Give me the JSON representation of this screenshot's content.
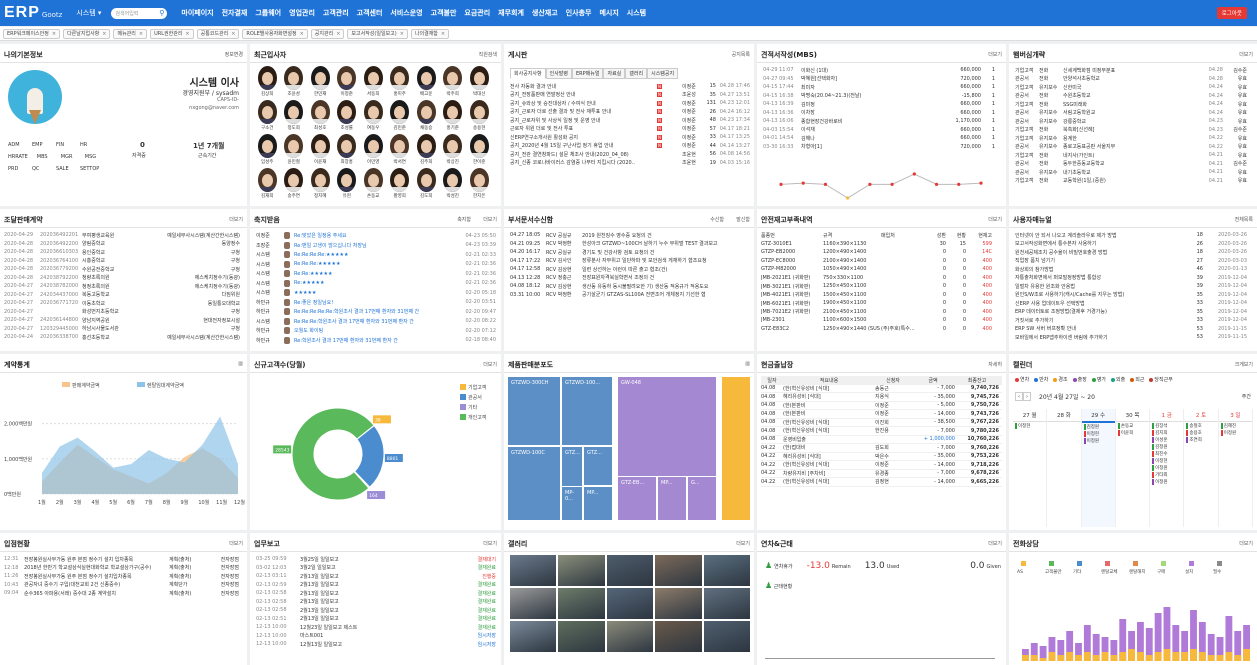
{
  "topbar": {
    "logo": "ERP",
    "logo_sub": "Gootz",
    "system_menu": "시스템 ▾",
    "search_placeholder": "검색어입력",
    "logout": "로그아웃",
    "menus": [
      "마이페이지",
      "전자결재",
      "그룹웨어",
      "영업관리",
      "고객관리",
      "고객센터",
      "서비스운영",
      "고객불만",
      "요금관리",
      "재무회계",
      "생산재고",
      "인사총무",
      "메시지",
      "시스템"
    ]
  },
  "tabs": [
    "ERP워크페이스안정",
    "다른날지업사항",
    "메뉴관리",
    "URL권한관리",
    "공통코드관리",
    "ROLE별사용자화면설정",
    "공지관리",
    "보고서작성(일일보고)",
    "나의결재함"
  ],
  "profile": {
    "title": "나의기본정보",
    "manage": "정보변경",
    "name": "시스템 이사",
    "org": "경영지원부 / sysadm",
    "caps": "CAPS-ID-",
    "email": "nxgong@naver.com",
    "roles": [
      "ADM",
      "EMP",
      "FIN",
      "HR",
      "HRRATE",
      "MBS",
      "MGR",
      "MSG",
      "PRD",
      "QC",
      "SALE",
      "SETTOP"
    ],
    "stat1_value": "0",
    "stat1_label": "자격증",
    "stat2_value": "1년 7개월",
    "stat2_label": "근속기간"
  },
  "recent_users": {
    "title": "최근입사자",
    "names": [
      "김상희",
      "조윤성",
      "한민재",
      "이정준",
      "서동희",
      "홍미주",
      "배고운",
      "박주희",
      "박대선",
      "구소건",
      "정도희",
      "최성호",
      "조성률",
      "여동우",
      "김민준",
      "채동승",
      "홍기준",
      "송용현",
      "임성주",
      "윤민철",
      "이윤재",
      "최장홍",
      "이민영",
      "박서연",
      "김주희",
      "박상진",
      "한이준",
      "김재희",
      "송주연",
      "정지혜",
      "유현",
      "손동교",
      "황영희",
      "김도희",
      "박성진",
      "한지은"
    ]
  },
  "board": {
    "title": "게시판",
    "more": "공지목록",
    "tabs": [
      "회사공지사항",
      "인사발령",
      "ERP매뉴얼",
      "자료실",
      "갤러리",
      "시스템공지"
    ],
    "rows": [
      [
        "전사 자동화 결과 안내",
        "이정준",
        "15",
        "04.28 17:46"
      ],
      [
        "공지_전장품판매 연말정산 안내",
        "조윤성",
        "35",
        "04.27 13:51"
      ],
      [
        "공지_슈와상 및 승진대상자 / 수여식 안내",
        "이정준",
        "131",
        "04.23 12:01"
      ],
      [
        "공지_근로자 더로 선출 결과 및 전사 재투표 안내",
        "이정준",
        "26",
        "04.24 16:12"
      ],
      [
        "공지_근로자위 및 사상식 일정 및 운영 안내",
        "이정준",
        "48",
        "04.23 17:34"
      ],
      [
        "근로자 위원 더로 및 전사 투표",
        "이정준",
        "57",
        "04.17 18:21"
      ],
      [
        "신ERP연구소개사원 활성화 공지",
        "이정준",
        "33",
        "04.17 13:25"
      ],
      [
        "공지_2020년 4월 15일 구난사업 정기 휴업 안내",
        "이정준",
        "44",
        "04.14 13:27"
      ],
      [
        "공지_전관 결연창파드) 설문 체조사 안내(2020_04_08)",
        "조윤현",
        "56",
        "04.08 14:56"
      ],
      [
        "공지_신종 코로나바이러스 감염증 나부터 지킵시다 (2020..",
        "조윤현",
        "19",
        "04.03 15:16"
      ]
    ]
  },
  "mbs": {
    "title": "견적서작성(MBS)",
    "more": "더보기",
    "rows": [
      [
        "04-29 11:07",
        "이화신 (1대)",
        "660,000",
        "1"
      ],
      [
        "04-27 09:45",
        "박혜원[선택화자]",
        "720,000",
        "1"
      ],
      [
        "04-15 17:44",
        "최미자",
        "660,000",
        "1"
      ],
      [
        "04-15 16:38",
        "박명숙(20.04~21.3)(전날)",
        "-15,800",
        "1"
      ],
      [
        "04-13 16:39",
        "김미정",
        "660,000",
        "1"
      ],
      [
        "04-13 16:36",
        "이차장",
        "660,000",
        "1"
      ],
      [
        "04-13 16:06",
        "종합현장건강바로비",
        "1,170,000",
        "1"
      ],
      [
        "04-03 15:54",
        "이석재",
        "660,000",
        "1"
      ],
      [
        "04-01 14:54",
        "김해나",
        "660,000",
        "1"
      ],
      [
        "03-30 16:33",
        "차형아[1]",
        "720,000",
        "1"
      ]
    ],
    "spark": [
      660000,
      720000,
      660000,
      -15800,
      660000,
      660000,
      1170000,
      660000,
      660000,
      720000
    ]
  },
  "prospect": {
    "title": "햄버심개략",
    "more": "더보기",
    "rows": [
      [
        "기업고객",
        "전화",
        "신세계백화점 미정부분표",
        "04.28",
        "김수준"
      ],
      [
        "관공서",
        "전화",
        "안양석사초등학교",
        "04.28",
        "유효"
      ],
      [
        "기업고객",
        "유지보수",
        "신한미국",
        "04.24",
        "유효"
      ],
      [
        "관공서",
        "전화",
        "수원초등학교",
        "04.24",
        "유효"
      ],
      [
        "기업고객",
        "전화",
        "SSG미래화",
        "04.24",
        "유효"
      ],
      [
        "관공서",
        "유지보수",
        "서림고등학원교",
        "04.24",
        "유효"
      ],
      [
        "관공서",
        "유지보수",
        "강릉중학교",
        "04.23",
        "유효"
      ],
      [
        "기업고객",
        "전화",
        "북측화[신선례]",
        "04.23",
        "김수준"
      ],
      [
        "기업고객",
        "유지보수",
        "용계한",
        "04.22",
        "유효"
      ],
      [
        "관공서",
        "유지보수",
        "종로고등표공판 서울지부",
        "04.22",
        "유효"
      ],
      [
        "기업고객",
        "전화",
        "네지사(가인트)",
        "04.21",
        "유효"
      ],
      [
        "관공서",
        "전화",
        "동두한중동교등학교",
        "04.21",
        "김수준"
      ],
      [
        "관공서",
        "유지보수",
        "내기초등학교",
        "04.21",
        "유효"
      ],
      [
        "기업고객",
        "전화",
        "교동학원(1일,(중원)",
        "04.21",
        "유효"
      ]
    ]
  },
  "contracts": {
    "title": "조달판매계약",
    "more": "더보기",
    "rows": [
      [
        "2020-04-29",
        "202036492201",
        "부여평생교육원",
        "예일세무사시스템(계산간한시스템)"
      ],
      [
        "2020-04-28",
        "202036492200",
        "양림중학교",
        "동양정수"
      ],
      [
        "2020-04-28",
        "202036610303",
        "용인중학교",
        "구청"
      ],
      [
        "2020-04-28",
        "202036764100",
        "시흥중학교",
        "구청"
      ],
      [
        "2020-04-28",
        "202036779200",
        "수원공전중학교",
        "구청"
      ],
      [
        "2020-04-28",
        "242038792200",
        "청량초록의원",
        "에스케치정수기(동광)"
      ],
      [
        "2020-04-27",
        "242038782000",
        "청정초록의원",
        "에스케치정수기(동광)"
      ],
      [
        "2020-04-27",
        "242034437000",
        "복동고등학교",
        "다짐위원"
      ],
      [
        "2020-04-27",
        "202036771720",
        "이동초학교",
        "동일통오대학교"
      ],
      [
        "2020-04-27",
        "",
        "화성번지초등학교",
        "구청"
      ],
      [
        "2020-04-27",
        "242036144800",
        "양남지역공원",
        "현대전자정보시설"
      ],
      [
        "2020-04-27",
        "120329445000",
        "하남시사물도서관",
        "구청"
      ],
      [
        "2020-04-24",
        "202036338700",
        "홍선초등학교",
        "예일세무사시스템(계산간한시스템)"
      ]
    ]
  },
  "congrats": {
    "title": "축지받음",
    "more": "더보기",
    "more2": "축지함",
    "rows": [
      [
        "이정준",
        "Re:맞았은 일정용 주세요",
        "04-23 05:50"
      ],
      [
        "조장준",
        "Re:맨일 고생이 많으십니다 처장님",
        "04-23 03:39"
      ],
      [
        "시스템",
        "Re:Re:Re:Re:★★★★★",
        "02-21 02:33"
      ],
      [
        "시스템",
        "Re:Re:Re:★★★★★",
        "02-21 02:36"
      ],
      [
        "시스템",
        "Re:Re:★★★★★",
        "02-21 02:36"
      ],
      [
        "시스템",
        "Re:★★★★★",
        "02-21 02:36"
      ],
      [
        "시스템",
        "★★★★★",
        "02-20 05:18"
      ],
      [
        "하민규",
        "Re:좋은 정일님요!",
        "02-20 03:51"
      ],
      [
        "하민규",
        "Re:Re:Re:Re:Re:학원조사 결과 17번째 환자와 31번째 간",
        "02-20 09:47"
      ],
      [
        "시스템",
        "Re:Re:Re:학원조사 결과 17번째 환자와 31번째 환자 간",
        "02-20 08:22"
      ],
      [
        "하민규",
        "오월도 화이팅",
        "02-20 07:12"
      ],
      [
        "하민규",
        "Re:학원조사 결과 17번째 환자와 31번째 환자 간",
        "02-18 08:40"
      ]
    ]
  },
  "received_docs": {
    "title": "부서문서수신함",
    "more": "수신함",
    "more2": "발신함",
    "rows": [
      [
        "04.27 18:05",
        "RCV 공실규",
        "2019 원천징수 영수증 요청의 건"
      ],
      [
        "04.21 09:25",
        "RCV 박정환",
        "한성아크 GTZWD~100CH 날하기 누수 부위벌 TEST 결과보고"
      ],
      [
        "04.20 16:17",
        "RCV 공실규",
        "경기도 및 건강사항 검토 요청의 건"
      ],
      [
        "04.17 17:22",
        "RCV 김사인",
        "장류분사 자부위고 일단하파 및 보안검색 게재하기 협조요청"
      ],
      [
        "04.17 12:58",
        "RCV 김상현",
        "일련 상선하는 이런이 따른 출고 협조(건)"
      ],
      [
        "04.13 12:28",
        "RCV 정충근",
        "전장표원자격북실학면서 조정의 건"
      ],
      [
        "04.08 18:12",
        "RCV 김상현",
        "생산동 유동하 동시불필려요한 기) 생산동 적용규가 적용도요"
      ],
      [
        "03.31 10:00",
        "RCV 박정환",
        "공기살균기 GTZAS-SL100A 전면조어 개체정지 기선한 협"
      ]
    ]
  },
  "stock": {
    "title": "안전재고부족내역",
    "more": "더보기",
    "headers": [
      "품종번",
      "규격",
      "매입처",
      "성환",
      "현황",
      "현재고"
    ],
    "rows": [
      [
        "GTZ-3010E1",
        "1160×390×1130",
        "",
        "30",
        "15",
        "599"
      ],
      [
        "GTZP-EB2000",
        "1200×490×1400",
        "",
        "0",
        "0",
        "14C"
      ],
      [
        "GTZP-EC8000",
        "2100×490×1400",
        "",
        "0",
        "0",
        "400"
      ],
      [
        "GTZP-M82000",
        "1050×490×1400",
        "",
        "0",
        "0",
        "400"
      ],
      [
        "JMB-2021E1 (귀화판)",
        "750×330×1100",
        "",
        "0",
        "0",
        "400"
      ],
      [
        "JMB-3021E1 (귀화판)",
        "1250×450×1100",
        "",
        "0",
        "0",
        "400"
      ],
      [
        "JMB-4021E1 (귀화판)",
        "1500×450×1100",
        "",
        "0",
        "0",
        "400"
      ],
      [
        "JMB-6021E1 (귀화판)",
        "1900×450×1100",
        "",
        "0",
        "0",
        "400"
      ],
      [
        "JMB-7021E2 (귀화판)",
        "2100×450×1100",
        "",
        "0",
        "0",
        "400"
      ],
      [
        "JMB-2301",
        "1100×600×1500",
        "",
        "0",
        "0",
        "400"
      ],
      [
        "GTZ-E83C2",
        "1250×490×1440 (SUS 2...",
        "(주)주호(특수...",
        "0",
        "0",
        "400"
      ]
    ]
  },
  "manual": {
    "title": "사용자매뉴얼",
    "more": "전체목록",
    "rows": [
      [
        "인터넷이 안 되서 나오고 계리솔라우로 제가 방법",
        "18",
        "2020-03-26"
      ],
      [
        "보고서작성화면에서 통수본자 사용하기",
        "26",
        "2020-03-26"
      ],
      [
        "원천세공제조치 공수율이 비밀번호출경 방법",
        "18",
        "2020-03-26"
      ],
      [
        "직업장 폼치 넘기기",
        "27",
        "2020-03-03"
      ],
      [
        "화상회의 참가방법",
        "46",
        "2020-01-13"
      ],
      [
        "자통출처화면에서 퍼보밀정정방법 통합성",
        "39",
        "2019-12-04"
      ],
      [
        "일벌차 유용한 원조화 안용법",
        "39",
        "2019-12-04"
      ],
      [
        "원인S/W조로 사용하기(캐시/Cache를 지우는 방법)",
        "35",
        "2019-12-04"
      ],
      [
        "신ERP 사용 업데이트우 선택방법",
        "33",
        "2019-12-04"
      ],
      [
        "ERP 데이터토로 조정방법(결제후 거경가능)",
        "35",
        "2019-12-04"
      ],
      [
        "거짓서로 추가하기",
        "33",
        "2019-12-04"
      ],
      [
        "ERP SW 서버 버프정확 안내",
        "53",
        "2019-11-15"
      ],
      [
        "모바일에서 ERP앱추하이센 버림에 추가하기",
        "53",
        "2019-11-15"
      ]
    ]
  },
  "contract_stats": {
    "title": "계약통계",
    "legend": [
      "판매계약금액",
      "렌탈임대계약금액"
    ],
    "yticks": [
      "2,000백만원",
      "1,000백만원",
      "0백만원"
    ],
    "chart_data": {
      "type": "area",
      "title": "계약통계",
      "categories": [
        "1월",
        "2월",
        "3월",
        "4월",
        "5월",
        "6월",
        "7월",
        "8월",
        "9월",
        "10월",
        "11월",
        "12월"
      ],
      "ylim": [
        0,
        2500
      ],
      "series": [
        {
          "name": "판매계약금액",
          "values": [
            350,
            900,
            1400,
            1050,
            700,
            500,
            300,
            600,
            1050,
            1300,
            1000,
            450
          ]
        },
        {
          "name": "렌탈임대계약금액",
          "values": [
            600,
            1350,
            1600,
            1200,
            750,
            850,
            1250,
            1000,
            900,
            1400,
            2200,
            850
          ]
        }
      ]
    }
  },
  "new_customers": {
    "title": "신규고객수(당월)",
    "more": "더보기",
    "legend": [
      "기업고객",
      "관공서",
      "기타",
      "개인고객"
    ],
    "chart_data": {
      "type": "pie",
      "title": "신규고객수(당월)",
      "categories": [
        "기업고객",
        "관공서",
        "기타",
        "개인고객"
      ],
      "values": [
        38,
        8801,
        164,
        28543
      ],
      "colors": [
        "#f6b93b",
        "#4a8ccd",
        "#9b8dd6",
        "#5ab95a"
      ]
    }
  },
  "product_dist": {
    "title": "제품판매분포도",
    "blocks": [
      "GTZWD-300CH",
      "GTZWD-100...",
      "GW-048",
      "GTZWD-100C",
      "GTZ...",
      "GTZ...",
      "MP-0...",
      "GTZ-EB...",
      "MP...",
      "G...",
      "MP..."
    ]
  },
  "cash": {
    "title": "현금출납장",
    "more": "자세히",
    "headers": [
      "일자",
      "적요내용",
      "신청자",
      "금액",
      "최종잔고"
    ],
    "rows": [
      [
        "04.08",
        "(한)혁신유성비 [식대]",
        "송동근",
        "- 7,000",
        "9,740,726"
      ],
      [
        "04.08",
        "혜리유성비 [식대]",
        "지용식",
        "- 35,000",
        "9,745,726"
      ],
      [
        "04.08",
        "(한)본판비",
        "이정준",
        "- 5,000",
        "9,750,726"
      ],
      [
        "04.08",
        "(한)본판비",
        "이정준",
        "- 14,000",
        "9,743,726"
      ],
      [
        "04.08",
        "(한)혁신유성비 [식대]",
        "이진희",
        "- 38,500",
        "9,767,226"
      ],
      [
        "04.08",
        "(한)혁신유성비 [식대]",
        "한진용",
        "- 7,000",
        "9,780,226"
      ],
      [
        "04.08",
        "운영비입출",
        "",
        "+ 1,000,000",
        "10,760,226"
      ],
      [
        "04.22",
        "(한)접대비",
        "김도희",
        "- 7,000",
        "9,760,226"
      ],
      [
        "04.22",
        "혜리유성비 [식대]",
        "박은수",
        "- 35,000",
        "9,753,226"
      ],
      [
        "04.22",
        "(한)혁신유성비 [식대]",
        "이정준",
        "- 14,000",
        "9,718,226"
      ],
      [
        "04.22",
        "차량유지비 [주차비]",
        "유경종",
        "- 7,000",
        "9,678,226"
      ],
      [
        "04.22",
        "(한)혁신유성비 [식대]",
        "김정현",
        "- 14,000",
        "9,665,226"
      ]
    ]
  },
  "calendar": {
    "title": "캘린더",
    "more": "크게보기",
    "legend": [
      "연차",
      "반차",
      "경조",
      "출장",
      "병가",
      "외출",
      "외근",
      "당직근무"
    ],
    "legend_colors": [
      "#e53935",
      "#1f73d6",
      "#f39c12",
      "#8e44ad",
      "#2e9e3f",
      "#16a085",
      "#d35400",
      "#c0392b"
    ],
    "range": "20년 4월 27일 ~ 20",
    "week": "주간",
    "days": [
      "27 월",
      "28 화",
      "29 수",
      "30 목",
      "1 금",
      "2 토",
      "3 일"
    ],
    "events": [
      [
        "이정현"
      ],
      [],
      [
        "김정원",
        "이정현",
        "이정원"
      ],
      [
        "손동교",
        "이윤희"
      ],
      [
        "김장석",
        "김지희",
        "이성훈",
        "김정원",
        "최진수",
        "이정현",
        "이정원",
        "기타외",
        "이정원"
      ],
      [
        "송철호",
        "송용호",
        "조연희"
      ],
      [
        "김혜진",
        "이정원"
      ]
    ]
  },
  "visits": {
    "title": "입점현황",
    "more": "더보기",
    "rows": [
      [
        "12:31",
        "전장봉원실사무가동 원주 본점 정수기 설치 입차종목",
        "계획(출처)",
        "전자장점"
      ],
      [
        "12:18",
        "2018년 한반기 학교설상식실현대화학교 학교설상가구(공수)",
        "계획(출처)",
        "전자장점"
      ],
      [
        "11:26",
        "전장봉원실사무가동 원주 본점 정수기 설치입차종목",
        "계획(출처)",
        "전자장점"
      ],
      [
        "10:43",
        "관공자녀 중수기 구입(대천교회 2건 신종중수)",
        "계획단가",
        "전자장점"
      ],
      [
        "09:04",
        "순수365 아파용(서래) 중수대 2종 계약설치",
        "계획(출처)",
        "전자장점"
      ]
    ]
  },
  "work_reports": {
    "title": "업무보고",
    "more": "더보기",
    "rows": [
      [
        "03-25 09:59",
        "3월25일 일일보고",
        "결재대기"
      ],
      [
        "03-02 12:03",
        "3월2일 일일보고",
        "결재완료"
      ],
      [
        "02-13 03:11",
        "2월13일 일일보고",
        "진행중"
      ],
      [
        "02-13 02:59",
        "2월13일 일일보고",
        "결재완료"
      ],
      [
        "02-13 02:58",
        "2월13일 일일보고",
        "결재완료"
      ],
      [
        "02-13 02:58",
        "2월13일 일일보고",
        "결재완료"
      ],
      [
        "02-13 02:58",
        "2월13일 일일보고",
        "결재완료"
      ],
      [
        "02-13 02:51",
        "2월13일 일일보고",
        "결재완료"
      ],
      [
        "12-13 10:00",
        "12월23일 일일보고 제스트",
        "결재완료"
      ],
      [
        "12-13 10:00",
        "마스트001",
        "임시저장"
      ],
      [
        "12-13 10:00",
        "12월13일 일일보고",
        "임시저장"
      ]
    ]
  },
  "gallery": {
    "title": "갤러리",
    "more": "더보기"
  },
  "leave": {
    "title": "연차&근태",
    "more": "더보기",
    "label1": "연차휴가",
    "remain": "-13.0",
    "remain_label": "Remain",
    "used": "13.0",
    "used_label": "Used",
    "given": "0.0",
    "given_label": "Given",
    "label2": "근태현황"
  },
  "consult": {
    "title": "전화상담",
    "more": "더보기",
    "legend": [
      "AS",
      "고객불만",
      "기타",
      "렌탈교체",
      "렌탈해지",
      "구매",
      "설치",
      "필수"
    ],
    "legend_colors": [
      "#f6b93b",
      "#5ab95a",
      "#4a8ccd",
      "#e56b6b",
      "#e0894a",
      "#a3d977",
      "#b07ad8",
      "#8a8a8a"
    ],
    "chart_data": {
      "type": "bar",
      "title": "전화상담",
      "categories": [
        "1",
        "2",
        "3",
        "4",
        "5",
        "6",
        "7",
        "8",
        "9",
        "10",
        "11",
        "12",
        "13",
        "14",
        "15",
        "16",
        "17",
        "18",
        "19",
        "20",
        "21",
        "22",
        "23",
        "24",
        "25",
        "26"
      ],
      "series": [
        {
          "name": "AS",
          "values": [
            2,
            2,
            1,
            3,
            2,
            3,
            2,
            3,
            2,
            3,
            2,
            3,
            4,
            3,
            2,
            3,
            4,
            3,
            3,
            4,
            3,
            2,
            2,
            3,
            2,
            4
          ]
        },
        {
          "name": "설치",
          "values": [
            4,
            6,
            5,
            8,
            7,
            10,
            6,
            12,
            9,
            8,
            7,
            14,
            10,
            13,
            11,
            16,
            18,
            12,
            10,
            17,
            13,
            9,
            8,
            15,
            10,
            12
          ]
        }
      ]
    }
  }
}
